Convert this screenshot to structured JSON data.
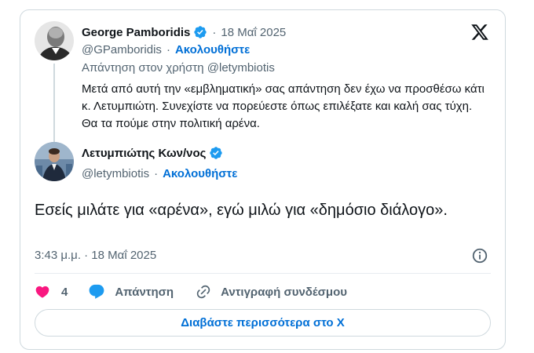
{
  "parent_tweet": {
    "author_name": "George Pamboridis",
    "date": "18 Μαΐ 2025",
    "handle": "@GPamboridis",
    "follow_label": "Ακολουθήστε",
    "replying_to": "Απάντηση στον χρήστη @letymbiotis",
    "text": "Μετά από αυτή την «εμβληματική» σας απάντηση δεν έχω να προσθέσω κάτι κ. Λετυμπιώτη. Συνεχίστε να πορεύεστε όπως επιλέξατε και καλή σας τύχη. Θα τα πούμε στην πολιτική αρένα.",
    "verified_badge_icon": "verified-badge-icon"
  },
  "reply_tweet": {
    "author_name": "Λετυμπιώτης Κων/νος",
    "handle": "@letymbiotis",
    "follow_label": "Ακολουθήστε",
    "text": "Εσείς μιλάτε για «αρένα», εγώ μιλώ για «δημόσιο διάλογο».",
    "timestamp": "3:43 μ.μ. · 18 Μαΐ 2025",
    "verified_badge_icon": "verified-badge-icon"
  },
  "actions": {
    "like_count": "4",
    "reply_label": "Απάντηση",
    "copy_link_label": "Αντιγραφή συνδέσμου"
  },
  "read_more_label": "Διαβάστε περισσότερα στο X",
  "separator": "·",
  "colors": {
    "accent": "#006fd6",
    "verified": "#1d9bf0",
    "like": "#f91880",
    "muted": "#536471",
    "border": "#cfd9de"
  }
}
